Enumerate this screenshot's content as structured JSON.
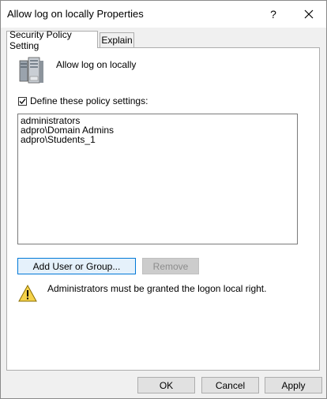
{
  "window": {
    "title": "Allow log on locally Properties",
    "help_glyph": "?"
  },
  "tabs": [
    {
      "label": "Security Policy Setting",
      "active": true
    },
    {
      "label": "Explain",
      "active": false
    }
  ],
  "policy": {
    "name": "Allow log on locally",
    "define_label": "Define these policy settings:",
    "define_checked": true
  },
  "accounts": [
    "administrators",
    "adpro\\Domain Admins",
    "adpro\\Students_1"
  ],
  "buttons": {
    "add": "Add User or Group...",
    "remove": "Remove",
    "ok": "OK",
    "cancel": "Cancel",
    "apply": "Apply"
  },
  "warning": {
    "text": "Administrators must be granted the logon local right."
  },
  "colors": {
    "focus_border": "#0078d7",
    "warning_fill": "#f5d24a"
  }
}
